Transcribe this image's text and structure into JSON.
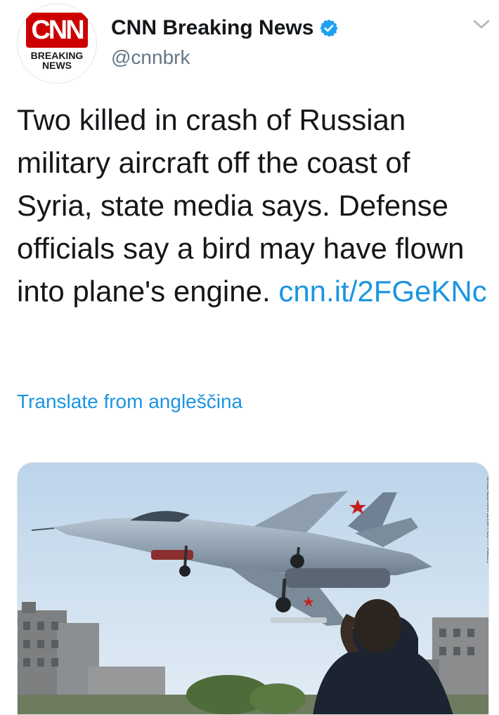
{
  "tweet": {
    "author_name": "CNN Breaking News",
    "author_handle": "@cnnbrk",
    "avatar": {
      "logo_text": "CNN",
      "badge_line1": "BREAKING",
      "badge_line2": "NEWS",
      "brand_color": "#cc0000"
    },
    "verified_icon": "verified-badge-icon",
    "verified_color": "#1da1f2",
    "menu_icon": "chevron-down-icon",
    "text": "Two killed in crash of Russian military aircraft off the coast of Syria, state media says. Defense officials say a bird may have flown into plane's engine.",
    "link": "cnn.it/2FGeKNc",
    "link_color": "#1b95e0",
    "translate_label": "Translate from angleščina",
    "media": {
      "kind": "photo",
      "subject": "fighter-jet-photo"
    }
  }
}
